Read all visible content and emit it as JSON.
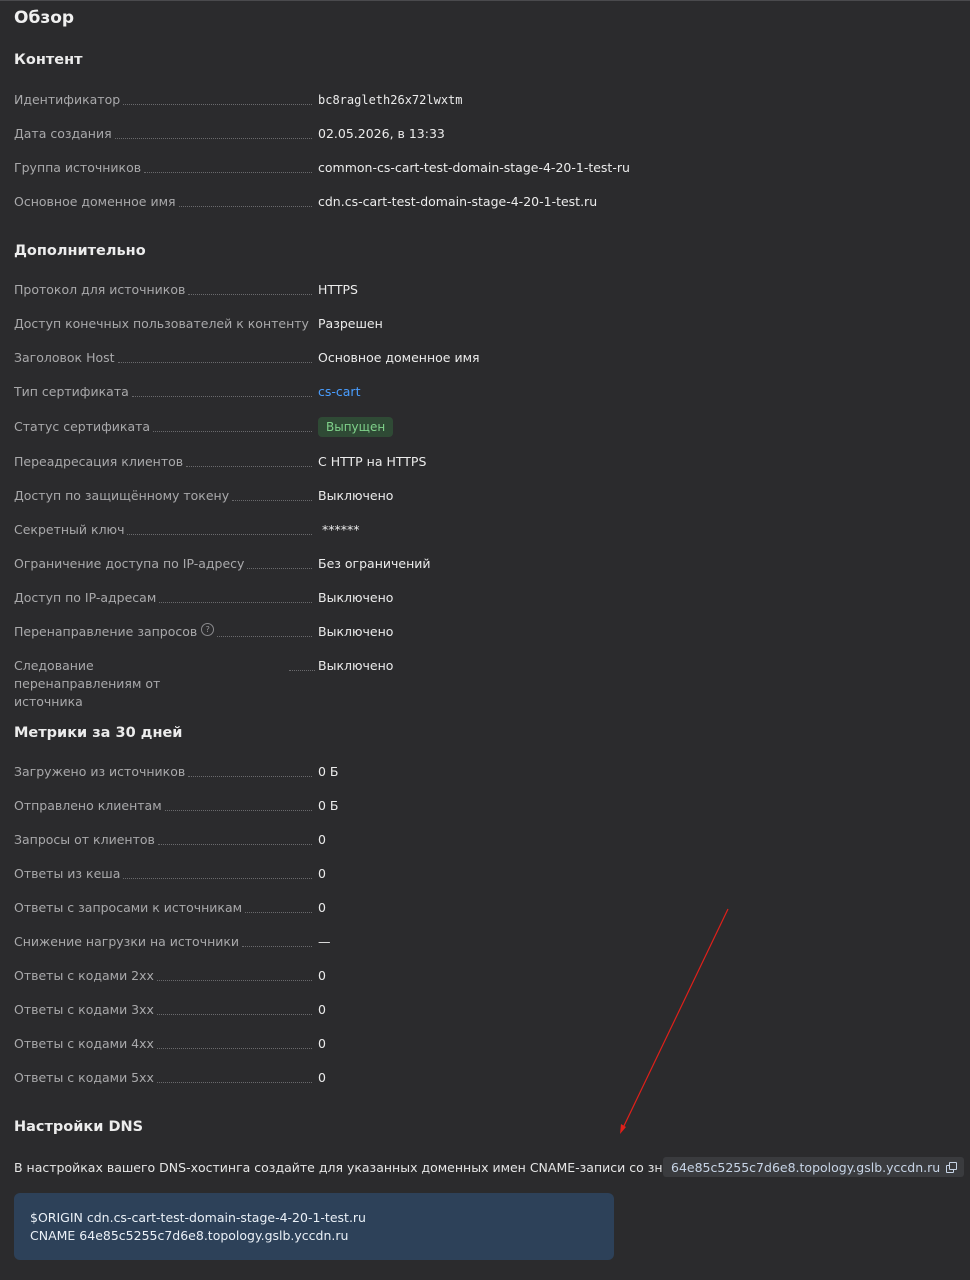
{
  "page": {
    "title": "Обзор"
  },
  "content": {
    "title": "Контент",
    "rows": [
      {
        "label": "Идентификатор",
        "value": "bc8ragleth26x72lwxtm"
      },
      {
        "label": "Дата создания",
        "value": "02.05.2026, в 13:33"
      },
      {
        "label": "Группа источников",
        "value": "common-cs-cart-test-domain-stage-4-20-1-test-ru"
      },
      {
        "label": "Основное доменное имя",
        "value": "cdn.cs-cart-test-domain-stage-4-20-1-test.ru"
      }
    ]
  },
  "additional": {
    "title": "Дополнительно",
    "rows": [
      {
        "label": "Протокол для источников",
        "value": "HTTPS"
      },
      {
        "label": "Доступ конечных пользователей к контенту",
        "value": "Разрешен"
      },
      {
        "label": "Заголовок Host",
        "value": "Основное доменное имя"
      },
      {
        "label": "Тип сертификата",
        "value": "cs-cart"
      },
      {
        "label": "Статус сертификата",
        "value": "Выпущен"
      },
      {
        "label": "Переадресация клиентов",
        "value": "С HTTP на HTTPS"
      },
      {
        "label": "Доступ по защищённому токену",
        "value": "Выключено"
      },
      {
        "label": "Секретный ключ",
        "value": "******"
      },
      {
        "label": "Ограничение доступа по IP-адресу",
        "value": "Без ограничений"
      },
      {
        "label": "Доступ по IP-адресам",
        "value": "Выключено"
      },
      {
        "label": "Перенаправление запросов",
        "value": "Выключено",
        "help_icon": "?"
      },
      {
        "label": "Следование перенаправлениям от источника",
        "value": "Выключено"
      }
    ]
  },
  "metrics": {
    "title": "Метрики за 30 дней",
    "rows": [
      {
        "label": "Загружено из источников",
        "value": "0 Б"
      },
      {
        "label": "Отправлено клиентам",
        "value": "0 Б"
      },
      {
        "label": "Запросы от клиентов",
        "value": "0"
      },
      {
        "label": "Ответы из кеша",
        "value": "0"
      },
      {
        "label": "Ответы с запросами к источникам",
        "value": "0"
      },
      {
        "label": "Снижение нагрузки на источники",
        "value": "—"
      },
      {
        "label": "Ответы с кодами 2xx",
        "value": "0"
      },
      {
        "label": "Ответы с кодами 3xx",
        "value": "0"
      },
      {
        "label": "Ответы с кодами 4xx",
        "value": "0"
      },
      {
        "label": "Ответы с кодами 5xx",
        "value": "0"
      }
    ]
  },
  "dns": {
    "title": "Настройки DNS",
    "instruction": "В настройках вашего DNS-хостинга создайте для указанных доменных имен CNAME-записи со значением",
    "cname_value": "64e85c5255c7d6e8.topology.gslb.yccdn.ru",
    "code_lines": [
      "$ORIGIN cdn.cs-cart-test-domain-stage-4-20-1-test.ru",
      "CNAME 64e85c5255c7d6e8.topology.gslb.yccdn.ru"
    ]
  },
  "colors": {
    "background": "#2b2b2d",
    "link": "#4a9eff",
    "badge_bg": "#2f4a35",
    "badge_text": "#7fd28a",
    "code_bg": "#2d4159",
    "annotation_arrow": "#e0201a"
  }
}
